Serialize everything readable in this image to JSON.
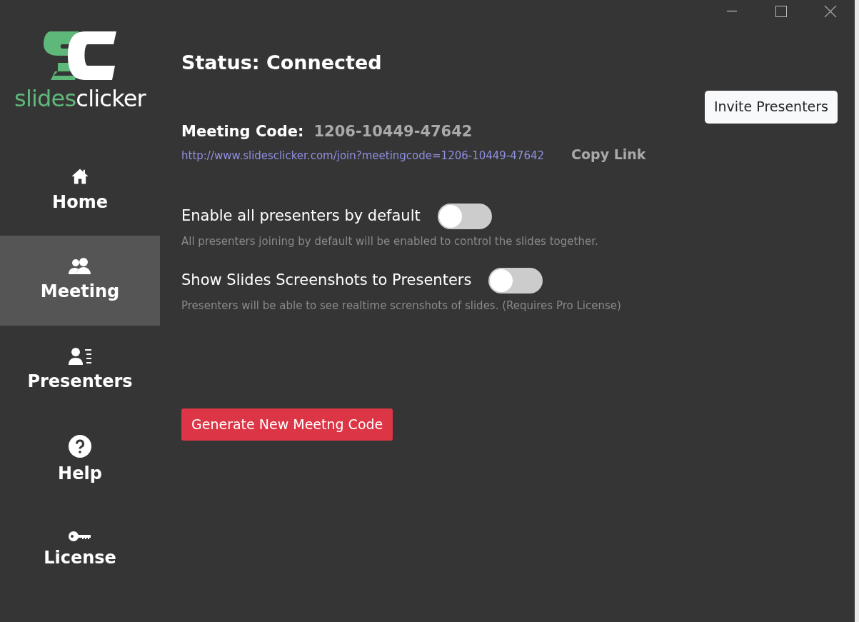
{
  "logo": {
    "first": "slides",
    "second": "clicker"
  },
  "sidebar": {
    "items": [
      {
        "label": "Home",
        "selected": false
      },
      {
        "label": "Meeting",
        "selected": true
      },
      {
        "label": "Presenters",
        "selected": false
      },
      {
        "label": "Help",
        "selected": false
      },
      {
        "label": "License",
        "selected": false
      }
    ]
  },
  "status": "Status: Connected",
  "invite_button": "Invite Presenters",
  "meeting_code": {
    "label": "Meeting Code:",
    "value": "1206-10449-47642",
    "link": "http://www.slidesclicker.com/join?meetingcode=1206-10449-47642",
    "copy": "Copy Link"
  },
  "settings": [
    {
      "label": "Enable all presenters by default",
      "on": false,
      "description": "All presenters joining by default will be enabled to control the slides together."
    },
    {
      "label": "Show Slides Screenshots to Presenters",
      "on": false,
      "description": "Presenters will be able to see realtime screnshots of slides. (Requires Pro License)"
    }
  ],
  "generate_button": "Generate New Meetng Code"
}
